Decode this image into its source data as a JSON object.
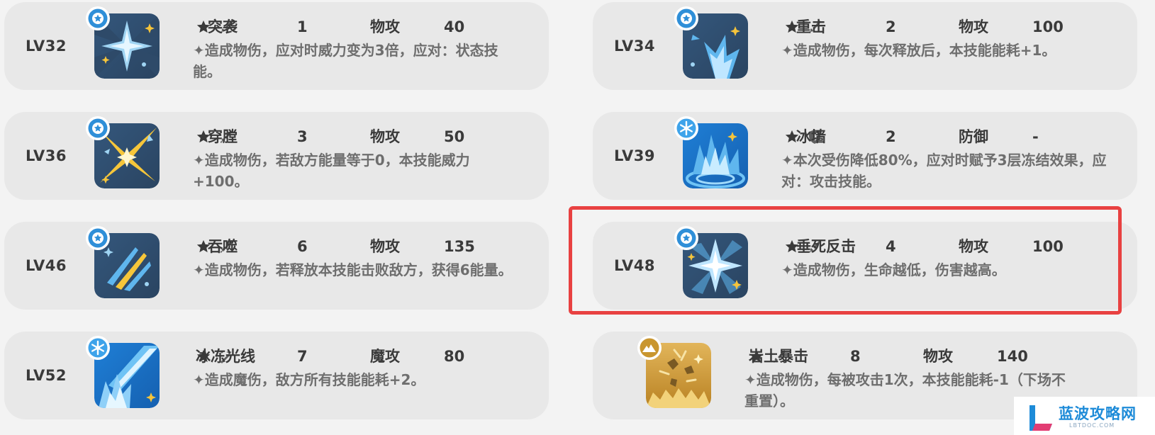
{
  "skills": [
    {
      "level": "LV32",
      "name": "突袭",
      "cost": "1",
      "category": "物攻",
      "power": "40",
      "description": "✦造成物伤，应对时威力变为3倍，应对：状态技能。",
      "icon": "sparkle-icon",
      "badge": "star-badge-icon",
      "category_icon": "sword-icon"
    },
    {
      "level": "LV34",
      "name": "重击",
      "cost": "2",
      "category": "物攻",
      "power": "100",
      "description": "✦造成物伤，每次释放后，本技能能耗+1。",
      "icon": "impact-icon",
      "badge": "star-badge-icon",
      "category_icon": "sword-icon"
    },
    {
      "level": "LV36",
      "name": "穿膛",
      "cost": "3",
      "category": "物攻",
      "power": "50",
      "description": "✦造成物伤，若敌方能量等于0，本技能威力+100。",
      "icon": "pierce-icon",
      "badge": "star-badge-icon",
      "category_icon": "sword-icon"
    },
    {
      "level": "LV39",
      "name": "冰墙",
      "cost": "2",
      "category": "防御",
      "power": "-",
      "description": "✦本次受伤降低80%，应对时赋予3层冻结效果，应对：攻击技能。",
      "icon": "ice-wall-icon",
      "badge": "snowflake-badge-icon",
      "category_icon": "shield-icon"
    },
    {
      "level": "LV46",
      "name": "吞噬",
      "cost": "6",
      "category": "物攻",
      "power": "135",
      "description": "✦造成物伤，若释放本技能击败敌方，获得6能量。",
      "icon": "claw-icon",
      "badge": "star-badge-icon",
      "category_icon": "sword-icon"
    },
    {
      "level": "LV48",
      "name": "垂死反击",
      "cost": "4",
      "category": "物攻",
      "power": "100",
      "description": "✦造成物伤，生命越低，伤害越高。",
      "icon": "sparkle-icon",
      "badge": "star-badge-icon",
      "category_icon": "sword-icon"
    },
    {
      "level": "LV52",
      "name": "冰冻光线",
      "cost": "7",
      "category": "魔攻",
      "power": "80",
      "description": "✦造成魔伤，敌方所有技能能耗+2。",
      "icon": "ice-beam-icon",
      "badge": "snowflake-badge-icon",
      "category_icon": "wand-icon"
    },
    {
      "level": "",
      "name": "岩土暴击",
      "cost": "8",
      "category": "物攻",
      "power": "140",
      "description": "✦造成物伤，每被攻击1次，本技能能耗-1（下场不重置）。",
      "icon": "rock-icon",
      "badge": "mountain-badge-icon",
      "category_icon": "sword-icon"
    }
  ],
  "highlighted_skill": "LV48",
  "watermark": {
    "name": "蓝波攻略网",
    "url": "LBTDOC.COM"
  },
  "colors": {
    "card_bg": "#e8e8e8",
    "highlight": "#e84141",
    "badge_blue": "#2f8fd8",
    "badge_gold": "#c9962f",
    "watermark": "#1d8bd8"
  }
}
